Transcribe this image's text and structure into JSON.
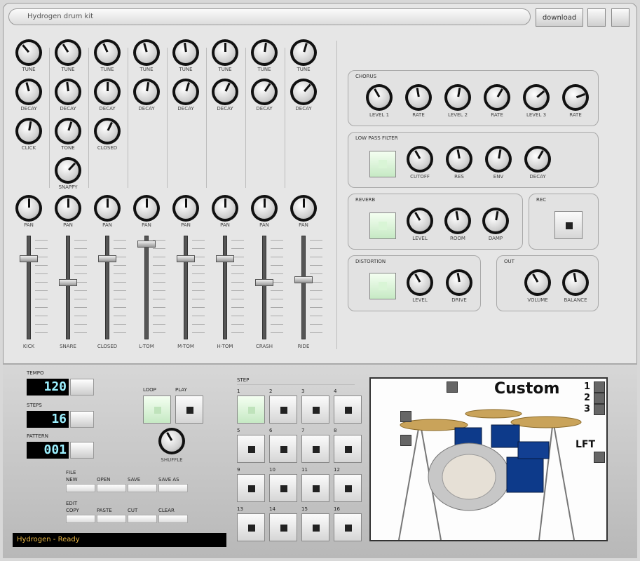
{
  "window": {
    "title": "Hydrogen drum kit",
    "button_label": "download",
    "minimize_icon": "minimize-icon",
    "close_icon": "close-icon"
  },
  "mixer": {
    "channels": [
      {
        "name": "KICK",
        "rows": [
          "TUNE",
          "DECAY",
          "CLICK"
        ],
        "pan": "PAN",
        "fader": 0.8
      },
      {
        "name": "SNARE",
        "rows": [
          "TUNE",
          "DECAY",
          "TONE",
          "SNAPPY"
        ],
        "pan": "PAN",
        "fader": 0.55
      },
      {
        "name": "CLOSED",
        "rows": [
          "TUNE",
          "DECAY",
          "CLOSED"
        ],
        "pan": "PAN",
        "fader": 0.8
      },
      {
        "name": "L-TOM",
        "rows": [
          "TUNE",
          "DECAY"
        ],
        "pan": "PAN",
        "fader": 0.95
      },
      {
        "name": "M-TOM",
        "rows": [
          "TUNE",
          "DECAY"
        ],
        "pan": "PAN",
        "fader": 0.8
      },
      {
        "name": "H-TOM",
        "rows": [
          "TUNE",
          "DECAY"
        ],
        "pan": "PAN",
        "fader": 0.8
      },
      {
        "name": "CRASH",
        "rows": [
          "TUNE",
          "DECAY"
        ],
        "pan": "PAN",
        "fader": 0.55
      },
      {
        "name": "RIDE",
        "rows": [
          "TUNE",
          "DECAY"
        ],
        "pan": "PAN",
        "fader": 0.58
      }
    ]
  },
  "fx": {
    "chorus": {
      "title": "CHORUS",
      "knobs": [
        "LEVEL 1",
        "RATE",
        "LEVEL 2",
        "RATE",
        "LEVEL 3",
        "RATE"
      ]
    },
    "filter": {
      "title": "LOW PASS FILTER",
      "knobs": [
        "CUTOFF",
        "RES",
        "ENV",
        "DECAY"
      ]
    },
    "reverb": {
      "title": "REVERB",
      "knobs": [
        "LEVEL",
        "ROOM",
        "DAMP"
      ]
    },
    "rec": {
      "title": "REC"
    },
    "distortion": {
      "title": "DISTORTION",
      "knobs": [
        "LEVEL",
        "DRIVE"
      ]
    },
    "out": {
      "title": "OUT",
      "knobs": [
        "VOLUME",
        "BALANCE"
      ]
    }
  },
  "transport": {
    "tempo_label": "TEMPO",
    "tempo_value": "120",
    "steps_label": "STEPS",
    "steps_value": "16",
    "pattern_label": "PATTERN",
    "pattern_value": "001",
    "loop_label": "LOOP",
    "play_label": "PLAY",
    "shuffle_label": "SHUFFLE",
    "file_label": "FILE",
    "file_buttons": [
      "NEW",
      "OPEN",
      "SAVE",
      "SAVE AS"
    ],
    "edit_label": "EDIT",
    "edit_buttons": [
      "COPY",
      "PASTE",
      "CUT",
      "CLEAR"
    ],
    "status_text": "Hydrogen - Ready"
  },
  "steps": {
    "label": "STEP",
    "numbers": [
      "1",
      "2",
      "3",
      "4",
      "5",
      "6",
      "7",
      "8",
      "9",
      "10",
      "11",
      "12",
      "13",
      "14",
      "15",
      "16"
    ],
    "active": [
      0
    ]
  },
  "kit": {
    "name": "Custom",
    "kit_numbers": [
      "1",
      "2",
      "3"
    ],
    "lft_label": "LFT"
  }
}
